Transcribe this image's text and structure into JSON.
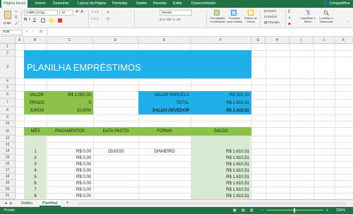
{
  "ribbon_tabs": [
    "Página Inicial",
    "Inserir",
    "Desenhar",
    "Layout da Página",
    "Fórmulas",
    "Dados",
    "Revisão",
    "Exibir",
    "Desenvolvedor"
  ],
  "share_label": "Compartilhar",
  "ribbon": {
    "paste": "Colar",
    "font_name": "Calibri (Corp...",
    "font_size": "12",
    "number_format": "Moeda",
    "cond_format": "Formatação Condicional",
    "format_table": "Formatar como Tabela",
    "cell_styles": "Estilos de Célula",
    "insert": "Inserir",
    "delete": "Excluir",
    "format": "Formato",
    "sort": "Classificar e Filtrar",
    "find": "Localizar e Selecionar"
  },
  "name_box": "E36",
  "fx_label": "fx",
  "columns": [
    "A",
    "B",
    "C",
    "D",
    "E",
    "F",
    "G",
    "H",
    "I",
    "J",
    "K"
  ],
  "rows": [
    "1",
    "2",
    "3",
    "4",
    "5",
    "6",
    "7",
    "8",
    "9",
    "10",
    "11",
    "12",
    "13",
    "14",
    "15",
    "16",
    "17",
    "18",
    "19",
    "20",
    "21"
  ],
  "sheet": {
    "title": "PLANILHA EMPRÉSTIMOS",
    "inputs": [
      {
        "label": "VALOR",
        "value": "R$ 1.000,00"
      },
      {
        "label": "PRAZO",
        "value": "5"
      },
      {
        "label": "JUROS",
        "value": "10,00%"
      }
    ],
    "results": [
      {
        "label": "VALOR PARCELA",
        "value": "R$ 322,10"
      },
      {
        "label": "TOTAL",
        "value": "R$ 1.610,51"
      },
      {
        "label": "SALDO DEVEDOR",
        "value": "R$ 1.610,51"
      }
    ],
    "table_headers": [
      "MÊS",
      "PAGAMENTOS",
      "DATA PAGTO",
      "FORMA",
      "SALDO"
    ],
    "table_rows": [
      {
        "mes": "1",
        "pagamento": "R$ 0,00",
        "data": "15/10/20",
        "forma": "DINHEIRO",
        "saldo": "R$ 1.610,51"
      },
      {
        "mes": "2",
        "pagamento": "R$ 0,00",
        "data": "",
        "forma": "",
        "saldo": "R$ 1.610,51"
      },
      {
        "mes": "3",
        "pagamento": "R$ 0,00",
        "data": "",
        "forma": "",
        "saldo": "R$ 1.610,51"
      },
      {
        "mes": "4",
        "pagamento": "R$ 0,00",
        "data": "",
        "forma": "",
        "saldo": "R$ 1.610,51"
      },
      {
        "mes": "5",
        "pagamento": "R$ 0,00",
        "data": "",
        "forma": "",
        "saldo": "R$ 1.610,51"
      },
      {
        "mes": "6",
        "pagamento": "R$ 0,00",
        "data": "",
        "forma": "",
        "saldo": "R$ 1.610,51"
      },
      {
        "mes": "7",
        "pagamento": "R$ 0,00",
        "data": "",
        "forma": "",
        "saldo": "R$ 1.610,51"
      },
      {
        "mes": "8",
        "pagamento": "R$ 0,00",
        "data": "",
        "forma": "",
        "saldo": "R$ 1.610,51"
      }
    ]
  },
  "sheet_tabs": [
    "Gráfico",
    "Planilha1"
  ],
  "add_sheet": "+",
  "status_text": "Pronto",
  "zoom": "150%",
  "colors": {
    "green": "#217346",
    "title_blue": "#1fb0e9",
    "light_green": "#8bc34a",
    "pale_green": "#d9ead3",
    "dark": "#1a1a1a"
  }
}
